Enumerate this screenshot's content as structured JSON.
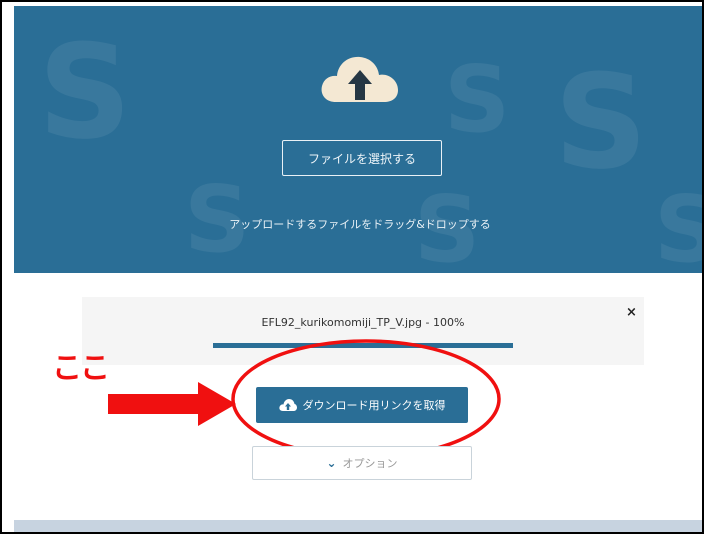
{
  "upload": {
    "select_button_label": "ファイルを選択する",
    "drop_hint": "アップロードするファイルをドラッグ&ドロップする"
  },
  "progress": {
    "file_name": "EFL92_kurikomomiji_TP_V.jpg",
    "percent_text": "100%",
    "line_text": "EFL92_kurikomomiji_TP_V.jpg - 100%",
    "fraction": 1.0,
    "close_glyph": "×"
  },
  "annotation": {
    "label": "ここ",
    "color": "#f01010"
  },
  "download": {
    "label": "ダウンロード用リンクを取得",
    "icon": "cloud-upload-icon"
  },
  "options": {
    "label": "オプション",
    "icon": "chevron-down-icon"
  },
  "colors": {
    "brand_blue": "#2a6e96",
    "card_bg": "#f5f5f5",
    "annotation_red": "#f01010"
  }
}
